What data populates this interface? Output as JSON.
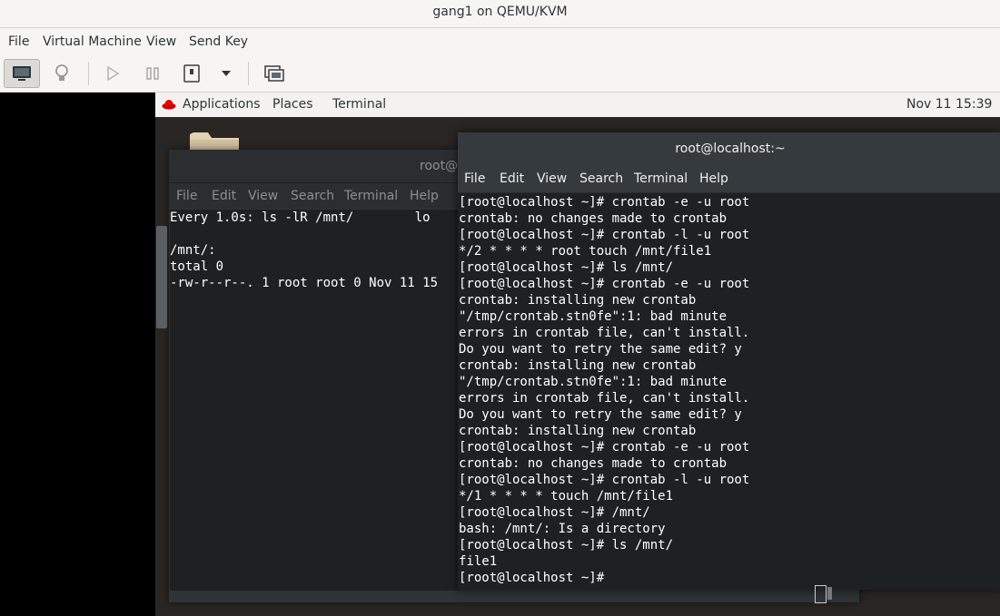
{
  "window": {
    "title": "gang1 on QEMU/KVM"
  },
  "host_menu": [
    "File",
    "Virtual Machine",
    "View",
    "Send Key"
  ],
  "host_toolbar": {
    "icons": [
      "monitor-icon",
      "lightbulb-icon",
      "play-icon",
      "pause-icon",
      "power-icon",
      "dropdown-icon",
      "fullscreen-icon"
    ]
  },
  "guest_topbar": {
    "applications": "Applications",
    "places": "Places",
    "terminal": "Terminal",
    "clock": "Nov 11  15:39"
  },
  "back_terminal": {
    "title": "root@",
    "menu": [
      "File",
      "Edit",
      "View",
      "Search",
      "Terminal",
      "Help"
    ],
    "lines": [
      "Every 1.0s: ls -lR /mnt/        lo",
      "",
      "/mnt/:",
      "total 0",
      "-rw-r--r--. 1 root root 0 Nov 11 15"
    ]
  },
  "front_terminal": {
    "title": "root@localhost:~",
    "menu": [
      "File",
      "Edit",
      "View",
      "Search",
      "Terminal",
      "Help"
    ],
    "lines": [
      "[root@localhost ~]# crontab -e -u root",
      "crontab: no changes made to crontab",
      "[root@localhost ~]# crontab -l -u root",
      "*/2 * * * * root touch /mnt/file1",
      "[root@localhost ~]# ls /mnt/",
      "[root@localhost ~]# crontab -e -u root",
      "crontab: installing new crontab",
      "\"/tmp/crontab.stn0fe\":1: bad minute",
      "errors in crontab file, can't install.",
      "Do you want to retry the same edit? y",
      "crontab: installing new crontab",
      "\"/tmp/crontab.stn0fe\":1: bad minute",
      "errors in crontab file, can't install.",
      "Do you want to retry the same edit? y",
      "crontab: installing new crontab",
      "[root@localhost ~]# crontab -e -u root",
      "crontab: no changes made to crontab",
      "[root@localhost ~]# crontab -l -u root",
      "*/1 * * * * touch /mnt/file1",
      "[root@localhost ~]# /mnt/",
      "bash: /mnt/: Is a directory",
      "[root@localhost ~]# ls /mnt/",
      "file1",
      "[root@localhost ~]#"
    ]
  }
}
